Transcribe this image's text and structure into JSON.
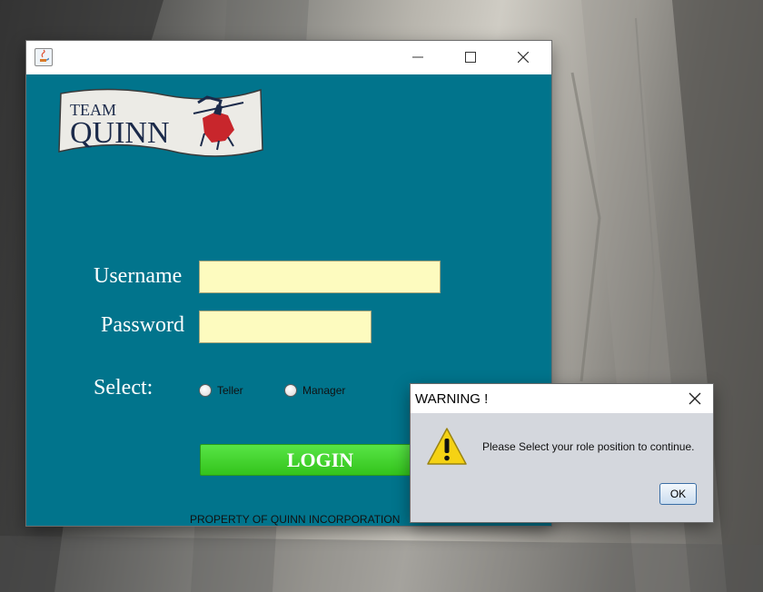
{
  "main_window": {
    "logo": {
      "line1": "TEAM",
      "line2": "QUINN"
    },
    "username_label": "Username",
    "password_label": "Password",
    "username_value": "",
    "password_value": "",
    "select_label": "Select:",
    "role_options": [
      "Teller",
      "Manager"
    ],
    "login_label": "LOGIN",
    "footer": "PROPERTY OF QUINN INCORPORATION"
  },
  "dialog": {
    "title": "WARNING !",
    "message": "Please Select your role position to continue.",
    "ok_label": "OK"
  },
  "colors": {
    "window_bg": "#01748c",
    "field_bg": "#fdfbbf",
    "login_green": "#3fd22a",
    "warning_yellow": "#f5d214"
  },
  "icons": [
    "java-app-icon",
    "minimize-icon",
    "maximize-icon",
    "close-icon",
    "warning-icon",
    "knight-icon"
  ]
}
